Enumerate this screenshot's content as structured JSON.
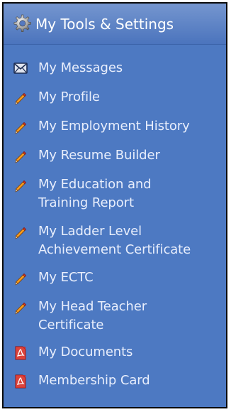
{
  "menu": {
    "title": "My Tools & Settings",
    "items": [
      {
        "label": "My Messages",
        "icon": "envelope-icon"
      },
      {
        "label": "My Profile",
        "icon": "pencil-icon"
      },
      {
        "label": "My Employment History",
        "icon": "pencil-icon"
      },
      {
        "label": "My Resume Builder",
        "icon": "pencil-icon"
      },
      {
        "label": "My Education and\nTraining Report",
        "icon": "pencil-icon"
      },
      {
        "label": "My Ladder Level\nAchievement Certificate",
        "icon": "pencil-icon"
      },
      {
        "label": "My ECTC",
        "icon": "pencil-icon"
      },
      {
        "label": "My Head Teacher\nCertificate",
        "icon": "pencil-icon"
      },
      {
        "label": "My Documents",
        "icon": "pdf-icon"
      },
      {
        "label": "Membership Card",
        "icon": "pdf-icon"
      }
    ]
  },
  "colors": {
    "panel_bg": "#4d79c2",
    "header_bg": "#6089cb",
    "text": "#e8eefc"
  }
}
